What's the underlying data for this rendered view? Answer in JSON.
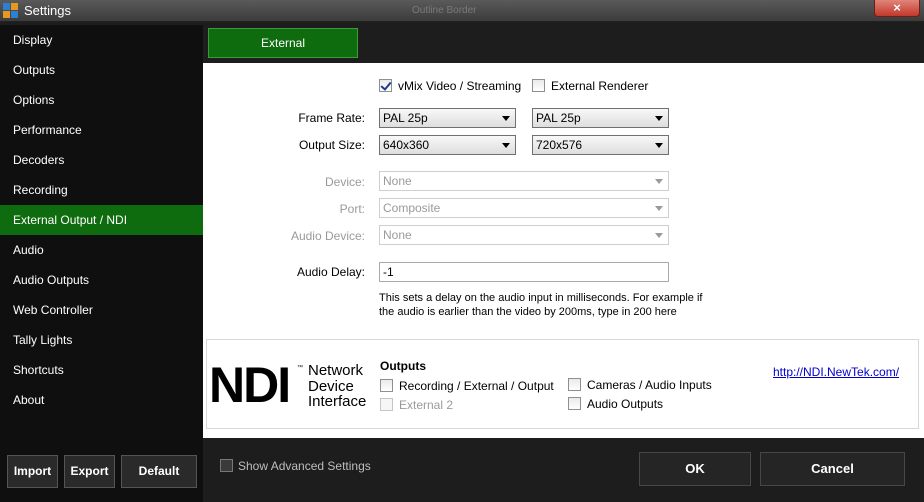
{
  "window": {
    "title": "Settings",
    "ghost_text": "Outline Border",
    "close_label": "×"
  },
  "sidebar": {
    "items": [
      "Display",
      "Outputs",
      "Options",
      "Performance",
      "Decoders",
      "Recording",
      "External Output / NDI",
      "Audio",
      "Audio Outputs",
      "Web Controller",
      "Tally Lights",
      "Shortcuts",
      "About"
    ],
    "active_index": 6,
    "buttons": {
      "import": "Import",
      "export": "Export",
      "default": "Default"
    }
  },
  "tabs": {
    "external": "External"
  },
  "form": {
    "vmix_video": {
      "label": "vMix Video / Streaming",
      "checked": true
    },
    "external_renderer": {
      "label": "External Renderer",
      "checked": false
    },
    "frame_rate": {
      "label": "Frame Rate:",
      "value1": "PAL 25p",
      "value2": "PAL 25p"
    },
    "output_size": {
      "label": "Output Size:",
      "value1": "640x360",
      "value2": "720x576"
    },
    "device": {
      "label": "Device:",
      "value": "None"
    },
    "port": {
      "label": "Port:",
      "value": "Composite"
    },
    "audio_device": {
      "label": "Audio Device:",
      "value": "None"
    },
    "audio_delay": {
      "label": "Audio Delay:",
      "value": "-1"
    },
    "help_text": "This sets a delay on the audio input in milliseconds. For example if the audio is earlier than the video by 200ms, type in 200 here"
  },
  "ndi": {
    "logo": "NDI",
    "tm": "™",
    "words": [
      "Network",
      "Device",
      "Interface"
    ],
    "outputs_title": "Outputs",
    "recording_external": "Recording / External / Output",
    "external2": "External 2",
    "cameras_audio": "Cameras / Audio Inputs",
    "audio_outputs": "Audio Outputs",
    "link": "http://NDI.NewTek.com/"
  },
  "footer": {
    "show_advanced": "Show Advanced Settings",
    "ok": "OK",
    "cancel": "Cancel"
  },
  "colors": {
    "accent_green": "#0e6b0e",
    "sidebar_bg": "#0f0f0f",
    "window_bg": "#1d1d1d"
  }
}
